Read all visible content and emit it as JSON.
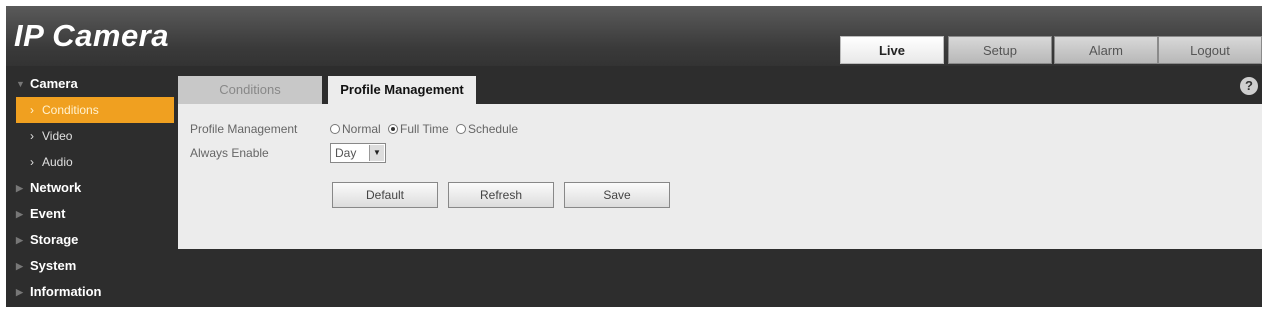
{
  "app": {
    "title_ip": "IP",
    "title_rest": " Camera"
  },
  "topnav": [
    {
      "label": "Live",
      "active": true
    },
    {
      "label": "Setup",
      "active": false
    },
    {
      "label": "Alarm",
      "active": false
    },
    {
      "label": "Logout",
      "active": false
    }
  ],
  "sidebar": {
    "camera": "Camera",
    "conditions": "Conditions",
    "video": "Video",
    "audio": "Audio",
    "network": "Network",
    "event": "Event",
    "storage": "Storage",
    "system": "System",
    "information": "Information"
  },
  "tabs": {
    "conditions": "Conditions",
    "profile": "Profile Management"
  },
  "help_icon": "?",
  "form": {
    "profile_label": "Profile Management",
    "options": {
      "normal": "Normal",
      "fulltime": "Full Time",
      "schedule": "Schedule"
    },
    "selected": "Full Time",
    "always_label": "Always Enable",
    "always_value": "Day"
  },
  "buttons": {
    "default": "Default",
    "refresh": "Refresh",
    "save": "Save"
  },
  "colors": {
    "accent": "#f0a020",
    "background": "#2d2d2d",
    "panel": "#ececec"
  }
}
